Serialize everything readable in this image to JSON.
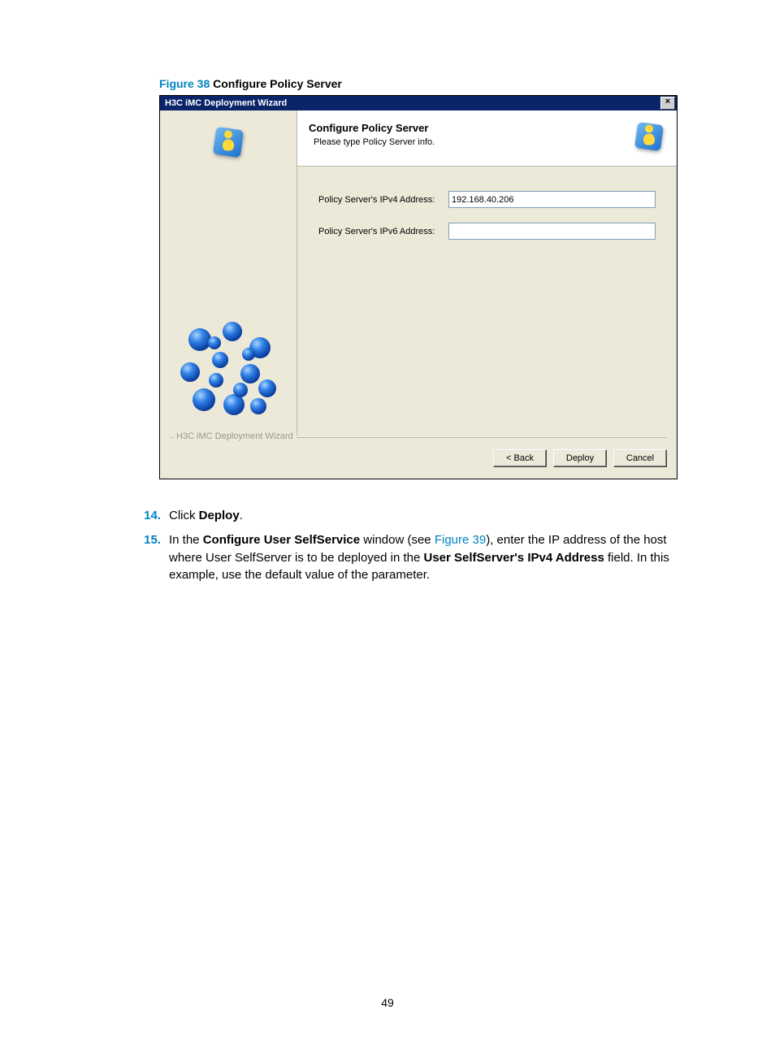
{
  "figure": {
    "label": "Figure 38",
    "title": "Configure Policy Server"
  },
  "window": {
    "title": "H3C iMC Deployment Wizard",
    "header_title": "Configure Policy Server",
    "header_sub": "Please type Policy Server info.",
    "footer_label": "H3C iMC Deployment Wizard",
    "fields": {
      "ipv4_label": "Policy Server's IPv4 Address:",
      "ipv4_value": "192.168.40.206",
      "ipv6_label": "Policy Server's IPv6 Address:",
      "ipv6_value": ""
    },
    "buttons": {
      "back": "< Back",
      "deploy": "Deploy",
      "cancel": "Cancel"
    },
    "close_glyph": "×"
  },
  "steps": {
    "s14": {
      "num": "14.",
      "pre": "Click ",
      "bold": "Deploy",
      "post": "."
    },
    "s15": {
      "num": "15.",
      "t1": "In the ",
      "b1": "Configure User SelfService",
      "t2": " window (see ",
      "link": "Figure 39",
      "t3": "), enter the IP address of the host where User SelfServer is to be deployed in the ",
      "b2": "User SelfServer's IPv4 Address",
      "t4": " field. In this example, use the default value of the parameter."
    }
  },
  "page_number": "49"
}
